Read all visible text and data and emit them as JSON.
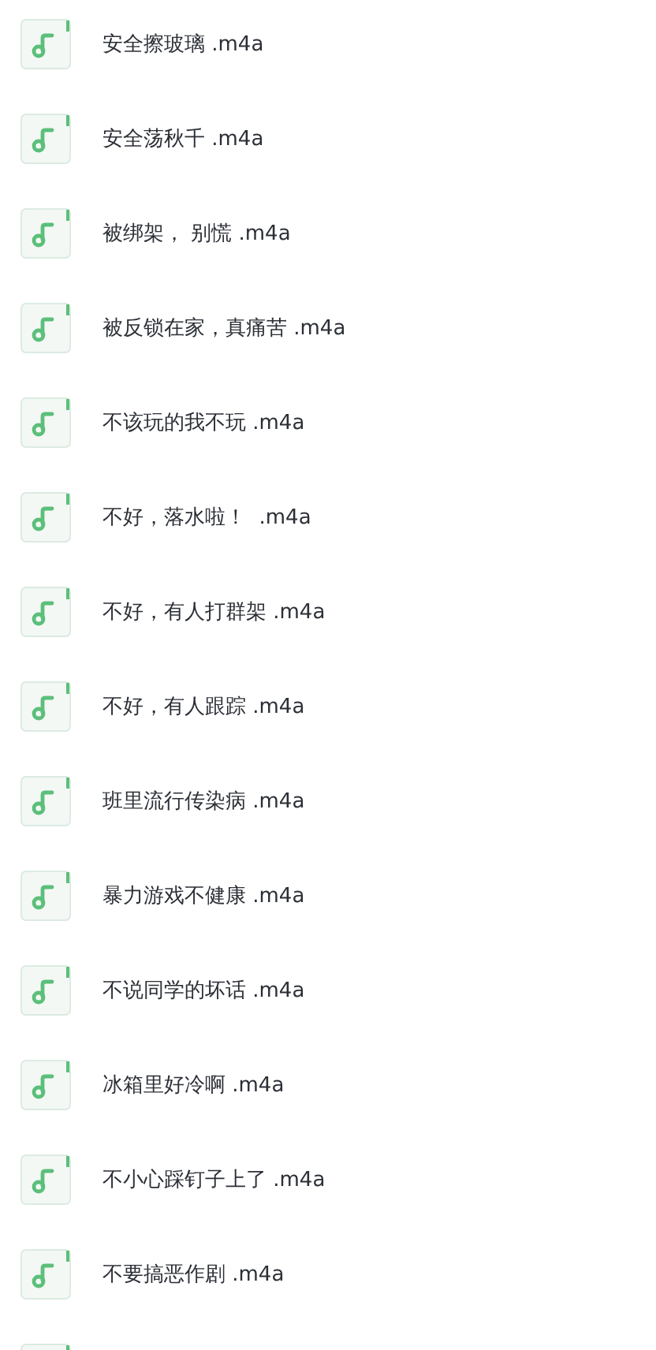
{
  "files": [
    {
      "kind": "file",
      "name": "安全擦玻璃 .m4a"
    },
    {
      "kind": "file",
      "name": "安全荡秋千 .m4a"
    },
    {
      "kind": "file",
      "name": "被绑架， 别慌 .m4a"
    },
    {
      "kind": "file",
      "name": "被反锁在家，真痛苦 .m4a"
    },
    {
      "kind": "file",
      "name": "不该玩的我不玩 .m4a"
    },
    {
      "kind": "file",
      "name": "不好，落水啦！  .m4a"
    },
    {
      "kind": "file",
      "name": "不好，有人打群架 .m4a"
    },
    {
      "kind": "file",
      "name": "不好，有人跟踪 .m4a"
    },
    {
      "kind": "file",
      "name": "班里流行传染病 .m4a"
    },
    {
      "kind": "file",
      "name": "暴力游戏不健康 .m4a"
    },
    {
      "kind": "file",
      "name": "不说同学的坏话 .m4a"
    },
    {
      "kind": "file",
      "name": "冰箱里好冷啊 .m4a"
    },
    {
      "kind": "file",
      "name": "不小心踩钉子上了 .m4a"
    },
    {
      "kind": "file",
      "name": "不要搞恶作剧 .m4a"
    },
    {
      "kind": "cut"
    }
  ]
}
